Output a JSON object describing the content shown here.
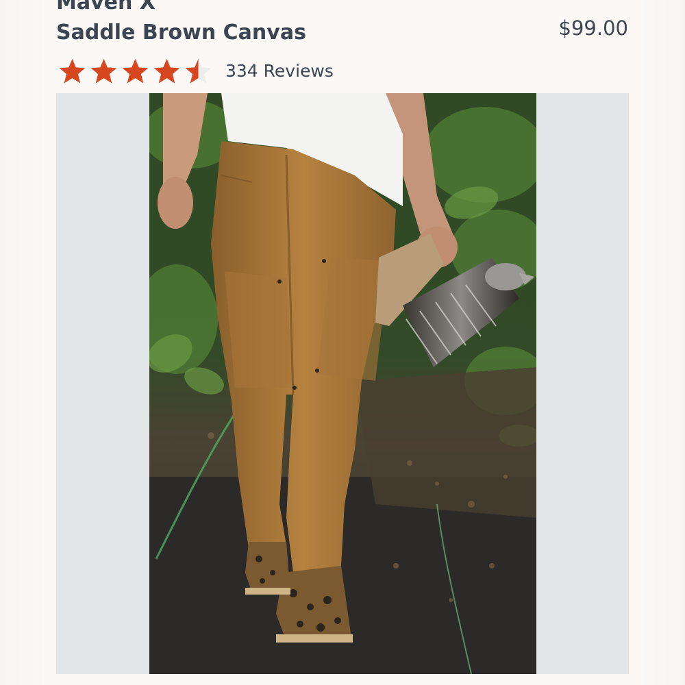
{
  "product": {
    "brand": "Maven X",
    "variant": "Saddle Brown Canvas",
    "price": "$99.00"
  },
  "rating": {
    "value": 4.5,
    "max": 5,
    "reviews_label": "334 Reviews"
  },
  "colors": {
    "star_fill": "#d6461f",
    "star_empty": "#ececec",
    "text": "#3b4652",
    "frame": "#e3e6e9"
  },
  "image": {
    "subject": "product-photo-work-pants"
  }
}
